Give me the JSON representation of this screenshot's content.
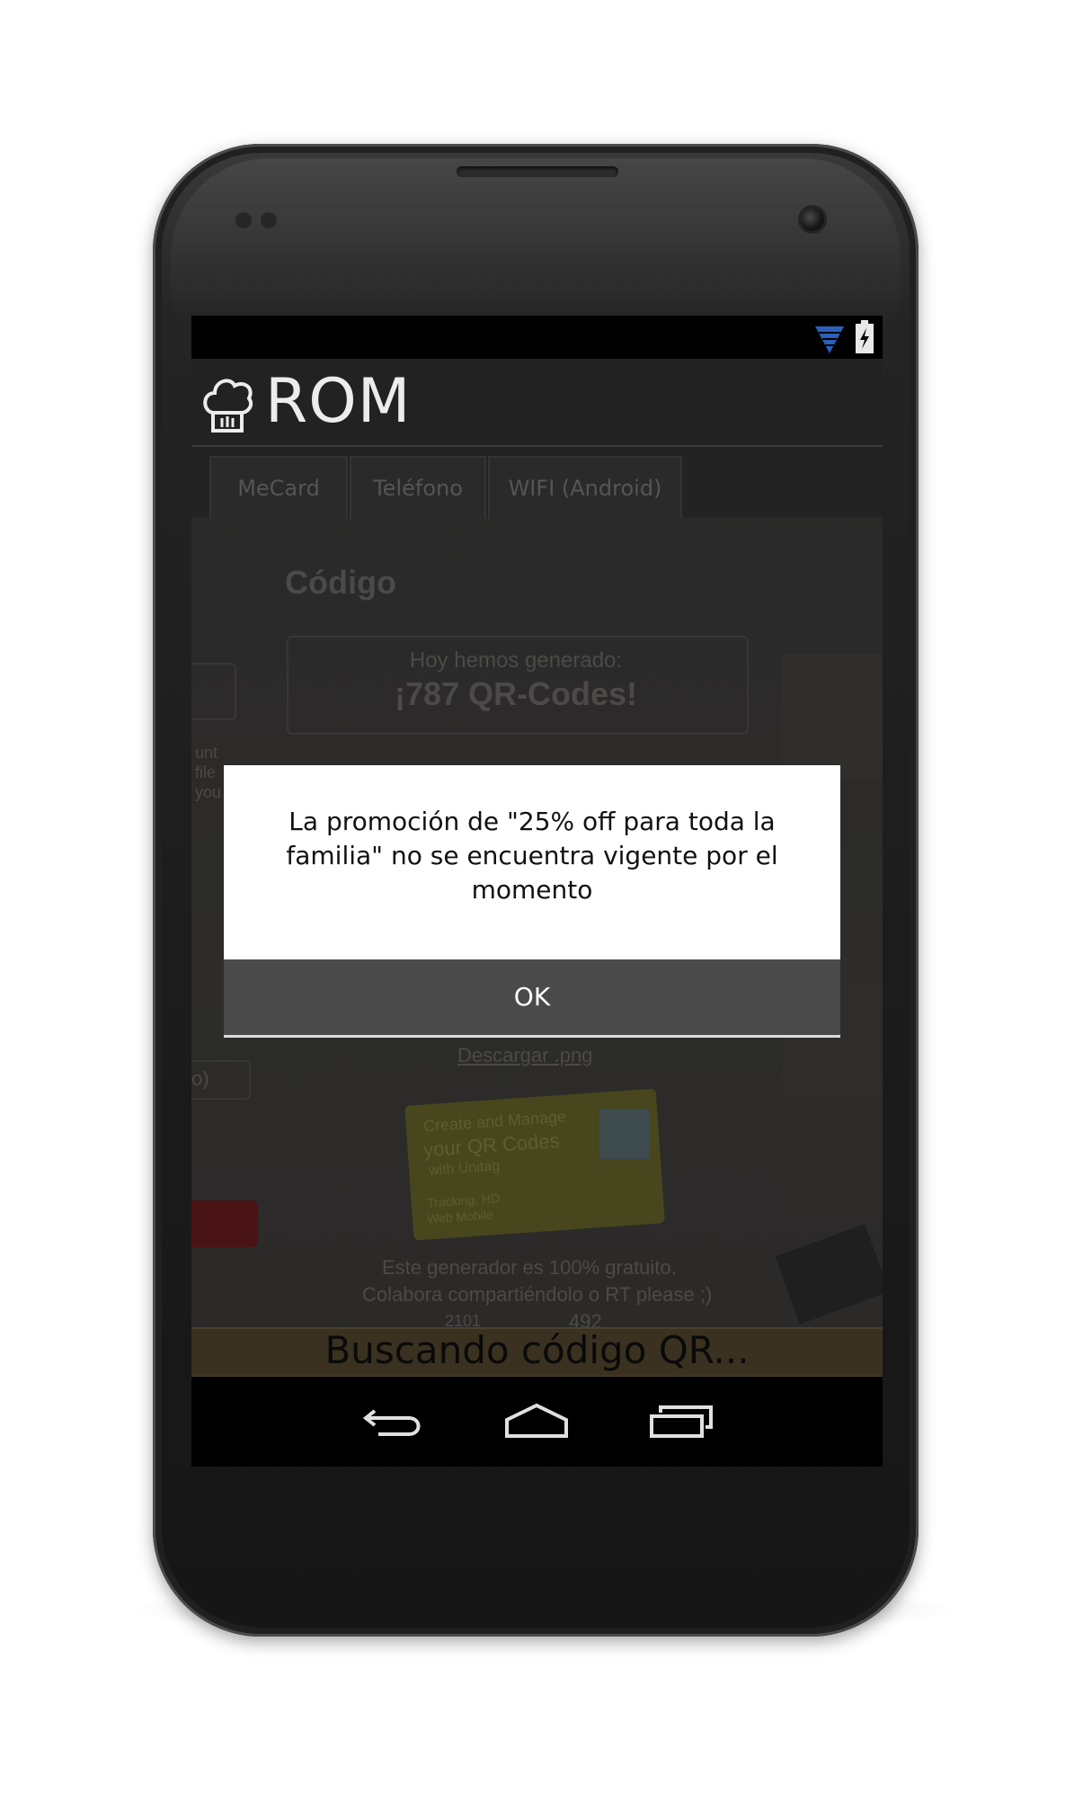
{
  "status_bar": {
    "icons": [
      "wifi-icon",
      "battery-charging-icon"
    ]
  },
  "action_bar": {
    "app_icon": "chef-hat-icon",
    "title": "ROM"
  },
  "camera_view": {
    "tabs": [
      "MeCard",
      "Teléfono",
      "WIFI (Android)"
    ],
    "heading": "Código",
    "counter_label": "Hoy hemos generado:",
    "counter_value": "¡787 QR-Codes!",
    "side_fragments": [
      "unt",
      "file",
      "you"
    ],
    "select_fragment": "o)",
    "download_link": "Descargar .png",
    "card_text": [
      "Create and Manage",
      "your QR Codes",
      "with Unitag",
      "Tracking, HD",
      "Web Mobile"
    ],
    "footer_line1": "Este generador es 100% gratuito.",
    "footer_line2": "Colabora compartiéndolo o RT please ;)",
    "like_count": "2101",
    "share_count": "492"
  },
  "scan_status": "Buscando código QR...",
  "dialog": {
    "message": "La promoción de \"25% off para toda la familia\" no se encuentra vigente por el momento",
    "ok_label": "OK"
  },
  "nav_bar": {
    "icons": [
      "back-icon",
      "home-icon",
      "recent-apps-icon"
    ]
  },
  "colors": {
    "action_bar": "#222222",
    "scan_bar": "#3a3121",
    "dialog_button": "#4a4a4a",
    "wifi": "#2b5fb8"
  }
}
